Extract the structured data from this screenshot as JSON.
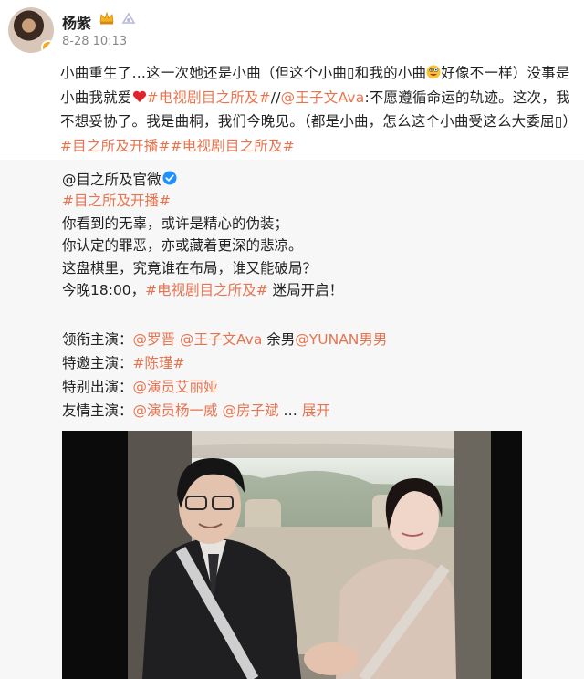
{
  "post": {
    "author": "杨紫",
    "time": "8-28 10:13",
    "text_a": "小曲重生了…这一次她还是小曲（但这个小曲",
    "text_b": "和我的小曲",
    "text_c": "好像不一样）没事是小曲我就爱",
    "tag1": "#电视剧目之所及#",
    "sep": "//",
    "mention": "@王子文Ava",
    "text_d": ":不愿遵循命运的轨迹。这次，我不想妥协了。我是曲桐，我们今晚见。（都是小曲，怎么这个小曲受这么大委屈",
    "tag2": "#目之所及开播#",
    "tag3": "#电视剧目之所及#",
    "heart_icon": "red-heart-icon",
    "emoji_icon": "crazy-face-emoji"
  },
  "repost": {
    "author": "@目之所及官微",
    "tag": "#目之所及开播#",
    "line1": "你看到的无辜，或许是精心的伪装；",
    "line2": "你认定的罪恶，亦或藏着更深的悲凉。",
    "line3": "这盘棋里，究竟谁在布局，谁又能破局？",
    "line4a": "今晚18:00，",
    "line4tag": "#电视剧目之所及#",
    "line4b": " 迷局开启！",
    "cast": {
      "lead_label": "领衔主演：",
      "lead1": "@罗晋",
      "lead2": "@王子文Ava",
      "lead3": " 余男",
      "lead4": "@YUNAN男男",
      "guest_label": "特邀主演：",
      "guest1": "#陈瑾#",
      "special_label": "特别出演：",
      "special1": "@演员艾丽娅",
      "friend_label": "友情主演：",
      "friend1": "@演员杨一威",
      "friend2": "@房子斌",
      "more_dots": "  … ",
      "expand": "展开"
    }
  },
  "colors": {
    "link": "#e8744f",
    "text": "#222222",
    "meta": "#888888",
    "repost_bg": "#f7f7f7"
  }
}
